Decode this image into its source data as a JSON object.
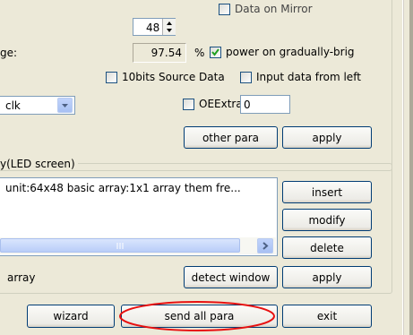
{
  "top": {
    "spin_value": "48",
    "mirror_label": "Data on Mirror",
    "page_label_partial": "ge:",
    "percent_value": "97.54",
    "percent_unit": "%",
    "power_label": "power on gradually-brig",
    "bits10_label": "10bits Source Data",
    "input_left_label": "Input data from left",
    "clock_select": "clk",
    "oeextra_label": "OEExtra",
    "oeextra_value": "0",
    "other_para": "other para",
    "apply": "apply"
  },
  "display_group": {
    "title": "y(LED screen)",
    "list_item": "unit:64x48 basic array:1x1 array them fre...",
    "insert": "insert",
    "modify": "modify",
    "delete": "delete",
    "array_label": "array",
    "detect_window": "detect window",
    "apply": "apply"
  },
  "bottom": {
    "wizard": "wizard",
    "send_all_para": "send all para",
    "exit": "exit"
  },
  "colors": {
    "highlight_ellipse": "#e81010",
    "scrollbar_thumb": "#c1d3fb",
    "window_bg": "#ece9d8"
  }
}
